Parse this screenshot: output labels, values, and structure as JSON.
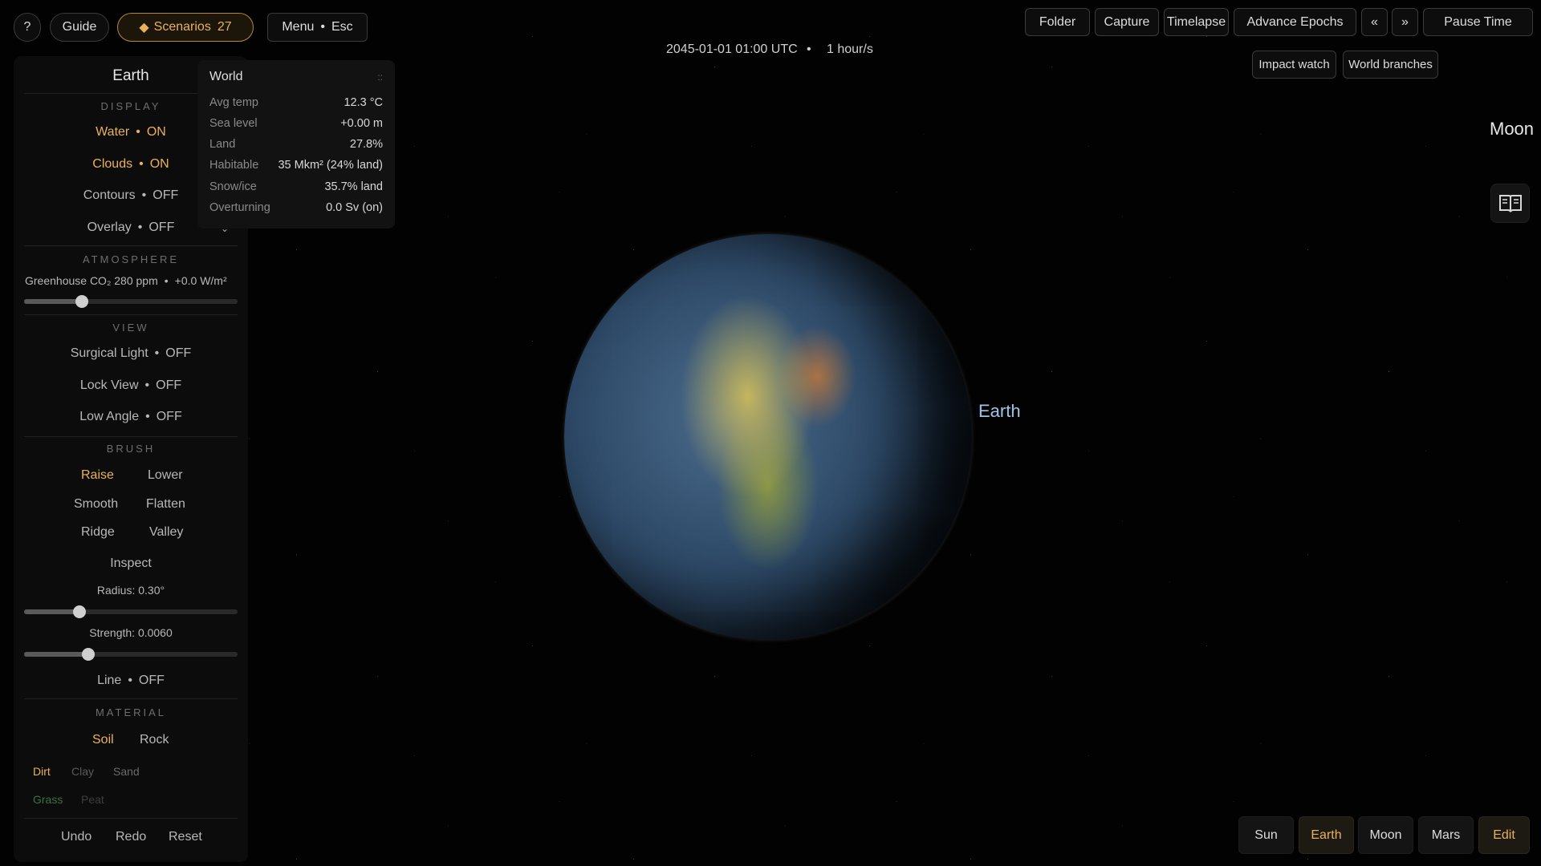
{
  "top_left": {
    "help_label": "?",
    "guide_label": "Guide",
    "scenarios_icon": "◆",
    "scenarios_label": "Scenarios",
    "scenarios_count": "27",
    "menu_label": "Menu",
    "menu_shortcut": "Esc"
  },
  "top_right": {
    "folder": "Folder",
    "capture": "Capture",
    "timelapse": "Timelapse",
    "advance_epochs": "Advance Epochs",
    "prev": "«",
    "next": "»",
    "pause_time": "Pause Time",
    "impact_watch": "Impact watch",
    "world_branches": "World branches"
  },
  "time": {
    "datetime": "2045-01-01 01:00 UTC",
    "separator": "•",
    "rate": "1 hour/s"
  },
  "panel": {
    "title": "Earth",
    "display_header": "DISPLAY",
    "water": "Water",
    "water_state": "ON",
    "clouds": "Clouds",
    "clouds_state": "ON",
    "contours": "Contours",
    "contours_state": "OFF",
    "overlay": "Overlay",
    "overlay_state": "OFF",
    "atmosphere_header": "ATMOSPHERE",
    "greenhouse_label": "Greenhouse CO₂ 280 ppm",
    "greenhouse_forcing": "+0.0 W/m²",
    "greenhouse_level": 0.27,
    "view_header": "VIEW",
    "surgical_light": "Surgical Light",
    "surgical_light_state": "OFF",
    "lock_view": "Lock View",
    "lock_view_state": "OFF",
    "low_angle": "Low Angle",
    "low_angle_state": "OFF",
    "brush_header": "BRUSH",
    "brush_tools": [
      "Raise",
      "Lower",
      "Smooth",
      "Flatten",
      "Ridge",
      "Valley",
      "Inspect"
    ],
    "radius_label": "Radius: 0.30°",
    "radius_level": 0.26,
    "strength_label": "Strength: 0.0060",
    "strength_level": 0.3,
    "line": "Line",
    "line_state": "OFF",
    "material_header": "MATERIAL",
    "material_types": [
      "Soil",
      "Rock"
    ],
    "materials": [
      "Dirt",
      "Clay",
      "Sand",
      "Grass",
      "Peat"
    ],
    "undo": "Undo",
    "redo": "Redo",
    "reset": "Reset"
  },
  "world_popup": {
    "title": "World",
    "grip": "::",
    "rows": [
      {
        "k": "Avg temp",
        "v": "12.3 °C"
      },
      {
        "k": "Sea level",
        "v": "+0.00 m"
      },
      {
        "k": "Land",
        "v": "27.8%"
      },
      {
        "k": "Habitable",
        "v": "35 Mkm² (24% land)"
      },
      {
        "k": "Snow/ice",
        "v": "35.7% land"
      },
      {
        "k": "Overturning",
        "v": "0.0 Sv (on)"
      }
    ]
  },
  "labels": {
    "earth": "Earth",
    "moon": "Moon"
  },
  "bottom_bar": [
    "Sun",
    "Earth",
    "Moon",
    "Mars",
    "Edit"
  ],
  "colors": {
    "accent": "#e8b25c",
    "label_blue": "#9ec4ea"
  }
}
